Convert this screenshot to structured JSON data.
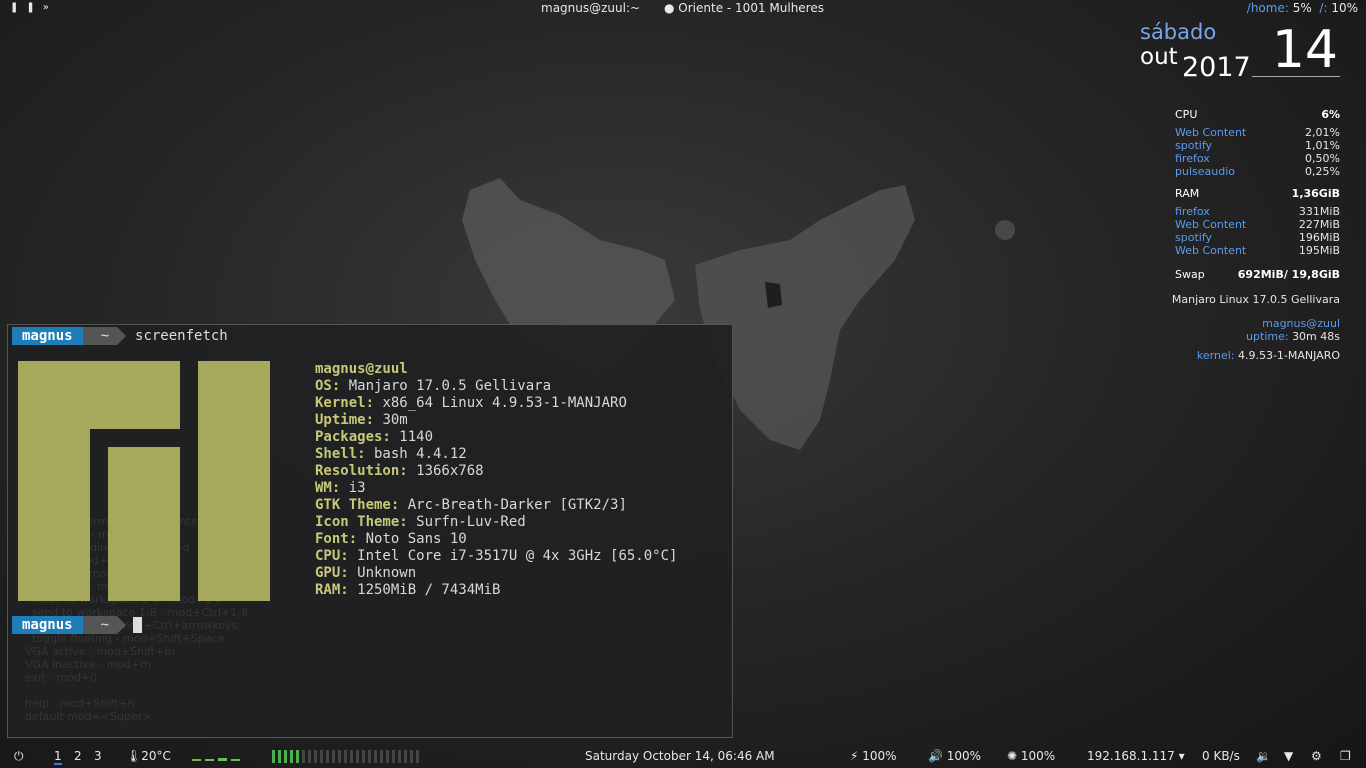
{
  "topbar": {
    "window_title": "magnus@zuul:~",
    "song": "Oriente - 1001 Mulheres",
    "disk_home_label": "/home:",
    "disk_home_value": "5%",
    "disk_root_label": "/:",
    "disk_root_value": "10%"
  },
  "conky": {
    "weekday": "sábado",
    "month": "out",
    "year": "2017",
    "day": "14",
    "cpu": {
      "label": "CPU",
      "total": "6%",
      "procs": [
        {
          "name": "Web Content",
          "value": "2,01%"
        },
        {
          "name": "spotify",
          "value": "1,01%"
        },
        {
          "name": "firefox",
          "value": "0,50%"
        },
        {
          "name": "pulseaudio",
          "value": "0,25%"
        }
      ]
    },
    "ram": {
      "label": "RAM",
      "total": "1,36GiB",
      "procs": [
        {
          "name": "firefox",
          "value": "331MiB"
        },
        {
          "name": "Web Content",
          "value": "227MiB"
        },
        {
          "name": "spotify",
          "value": "196MiB"
        },
        {
          "name": "Web Content",
          "value": "195MiB"
        }
      ]
    },
    "swap": {
      "label": "Swap",
      "value": "692MiB/ 19,8GiB"
    },
    "os": "Manjaro Linux 17.0.5 Gellivara",
    "user_host": "magnus@zuul",
    "uptime_label": "uptime:",
    "uptime_value": "30m 48s",
    "kernel_label": "kernel:",
    "kernel_value": "4.9.53-1-MANJARO"
  },
  "terminal": {
    "prompt_user": "magnus",
    "prompt_dir": "~",
    "command": "screenfetch",
    "user_host": "magnus@zuul",
    "fields": [
      {
        "key": "OS:",
        "value": " Manjaro 17.0.5 Gellivara"
      },
      {
        "key": "Kernel:",
        "value": " x86_64 Linux 4.9.53-1-MANJARO"
      },
      {
        "key": "Uptime:",
        "value": " 30m"
      },
      {
        "key": "Packages:",
        "value": " 1140"
      },
      {
        "key": "Shell:",
        "value": " bash 4.4.12"
      },
      {
        "key": "Resolution:",
        "value": " 1366x768"
      },
      {
        "key": "WM:",
        "value": " i3"
      },
      {
        "key": "GTK Theme:",
        "value": " Arc-Breath-Darker [GTK2/3]"
      },
      {
        "key": "Icon Theme:",
        "value": " Surfn-Luv-Red"
      },
      {
        "key": "Font:",
        "value": " Noto Sans 10"
      },
      {
        "key": "CPU:",
        "value": " Intel Core i7-3517U @ 4x 3GHz [65.0°C]"
      },
      {
        "key": "GPU:",
        "value": " Unknown"
      },
      {
        "key": "RAM:",
        "value": " 1250MiB / 7434MiB"
      }
    ],
    "logo_color": "#a6a85e"
  },
  "bottombar": {
    "workspaces": [
      "1",
      "2",
      "3"
    ],
    "active_workspace": "1",
    "temperature": "20°C",
    "datetime": "Saturday October 14, 06:46 AM",
    "battery": "100%",
    "volume": "100%",
    "brightness": "100%",
    "ip": "192.168.1.117",
    "netspeed": "0 KB/s",
    "cpu_level": 0.2
  },
  "colors": {
    "accent": "#1f7eb8",
    "link": "#5a9cf0",
    "logo": "#a6a85e"
  }
}
